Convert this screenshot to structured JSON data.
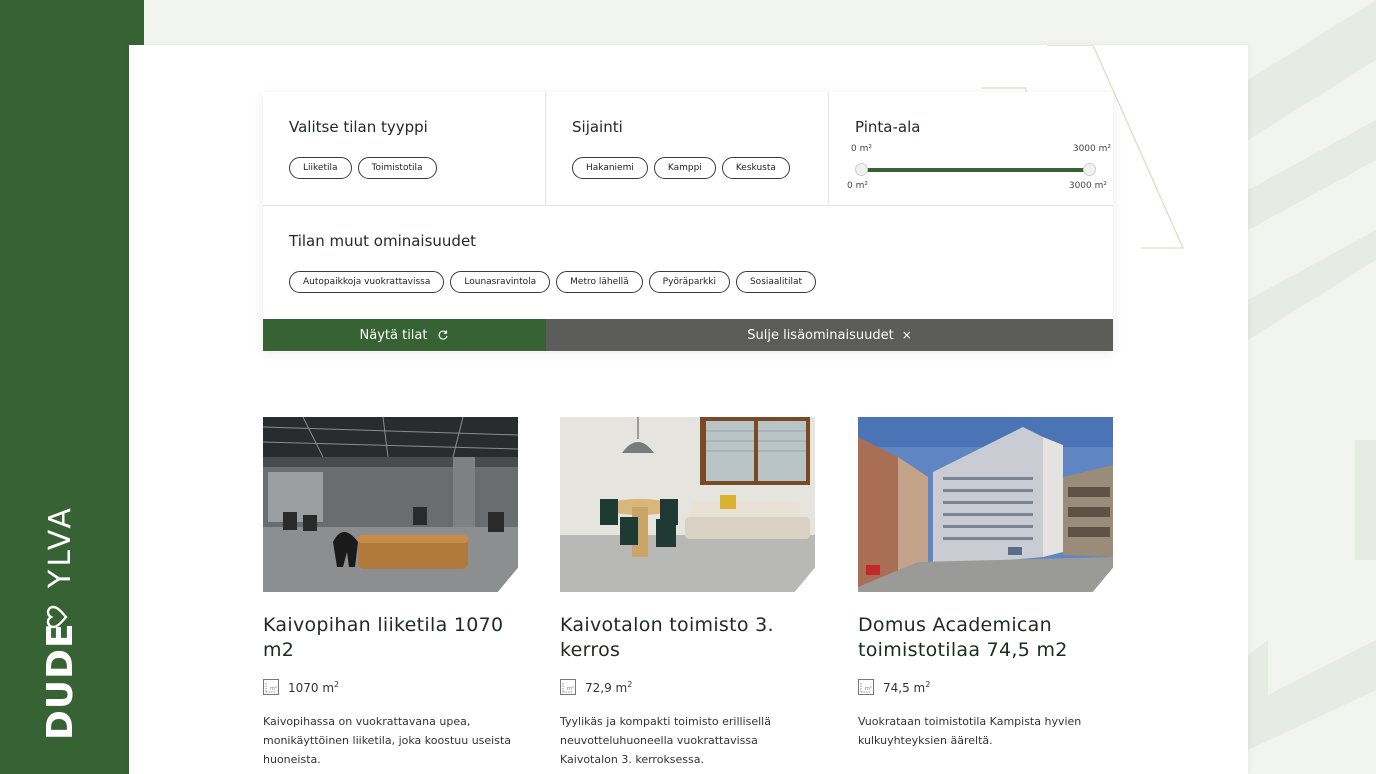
{
  "brand": {
    "name_a": "DUDE",
    "name_b": "YLVA"
  },
  "filters": {
    "type": {
      "title": "Valitse tilan tyyppi",
      "options": [
        "Liiketila",
        "Toimistotila"
      ]
    },
    "location": {
      "title": "Sijainti",
      "options": [
        "Hakaniemi",
        "Kamppi",
        "Keskusta"
      ]
    },
    "area": {
      "title": "Pinta-ala",
      "min_label_top": "0 m²",
      "max_label_top": "3000 m²",
      "min_label_bottom": "0 m²",
      "max_label_bottom": "3000 m²",
      "min": 0,
      "max": 3000,
      "selected": [
        0,
        3000
      ]
    },
    "other": {
      "title": "Tilan muut ominaisuudet",
      "options": [
        "Autopaikkoja vuokrattavissa",
        "Lounasravintola",
        "Metro lähellä",
        "Pyöräparkki",
        "Sosiaalitilat"
      ]
    },
    "show_label": "Näytä tilat",
    "close_label": "Sulje lisäominaisuudet",
    "close_icon": "×"
  },
  "listings": [
    {
      "title": "Kaivopihan liiketila 1070 m2",
      "area": "1070 m",
      "area_sup": "2",
      "description": "Kaivopihassa on vuokrattavana upea, monikäyttöinen liiketila, joka koostuu useista huoneista."
    },
    {
      "title": "Kaivotalon toimisto 3. kerros",
      "area": "72,9 m",
      "area_sup": "2",
      "description": "Tyylikäs ja kompakti toimisto erillisellä neuvotteluhuoneella vuokrattavissa Kaivotalon 3. kerroksessa."
    },
    {
      "title": "Domus Academican toimistotilaa 74,5 m2",
      "area": "74,5 m",
      "area_sup": "2",
      "description": "Vuokrataan toimistotila Kampista hyvien kulkuyhteyksien ääreltä."
    }
  ],
  "colors": {
    "brand_green": "#376334",
    "close_gray": "#5c5d5b"
  },
  "icons": {
    "area": "area-icon",
    "heart": "heart-icon",
    "show": "refresh-icon"
  }
}
